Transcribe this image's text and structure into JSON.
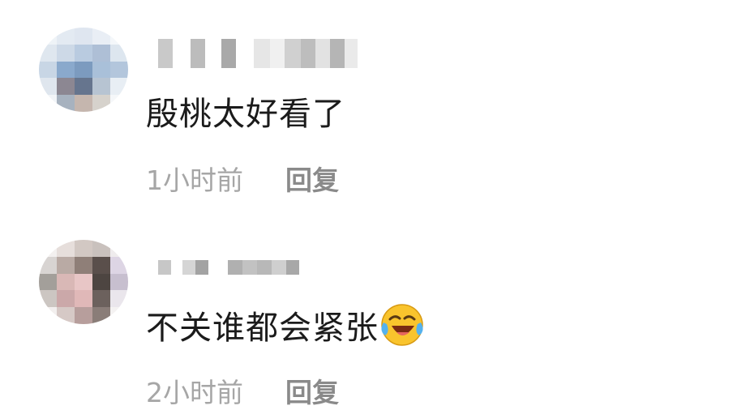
{
  "comments": [
    {
      "text": "殷桃太好看了",
      "time": "1小时前",
      "reply_label": "回复"
    },
    {
      "text": "不关谁都会紧张",
      "emoji": "laughing-crying-emoji",
      "time": "2小时前",
      "reply_label": "回复"
    }
  ],
  "colors": {
    "comment_text": "#1b1b1b",
    "meta_text": "#a6a6a6",
    "reply_text": "#8a8a8a"
  }
}
